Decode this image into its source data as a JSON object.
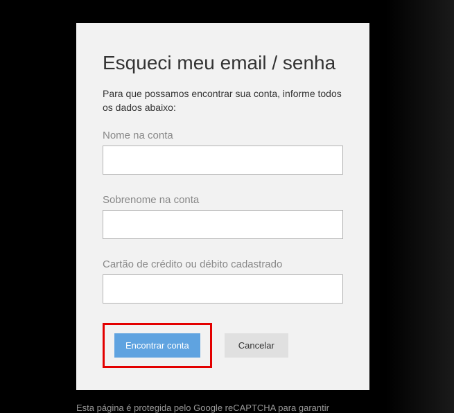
{
  "form": {
    "title": "Esqueci meu email / senha",
    "instructions": "Para que possamos encontrar sua conta, informe todos os dados abaixo:",
    "fields": {
      "firstName": {
        "label": "Nome na conta",
        "value": ""
      },
      "lastName": {
        "label": "Sobrenome na conta",
        "value": ""
      },
      "card": {
        "label": "Cartão de crédito ou débito cadastrado",
        "value": ""
      }
    },
    "buttons": {
      "submit": "Encontrar conta",
      "cancel": "Cancelar"
    }
  },
  "footer": "Esta página é protegida pelo Google reCAPTCHA para garantir"
}
